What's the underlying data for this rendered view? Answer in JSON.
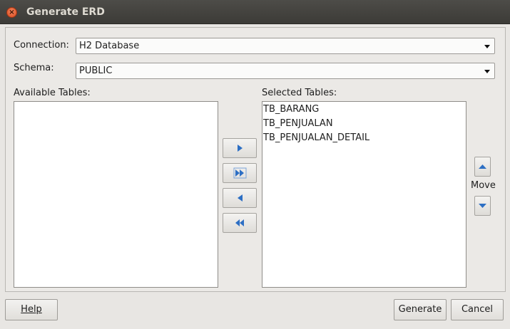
{
  "window": {
    "title": "Generate ERD"
  },
  "form": {
    "connection_label": "Connection:",
    "connection_value": "H2 Database",
    "schema_label": "Schema:",
    "schema_value": "PUBLIC"
  },
  "lists": {
    "available_label": "Available Tables:",
    "available_items": [],
    "selected_label": "Selected Tables:",
    "selected_items": [
      "TB_BARANG",
      "TB_PENJUALAN",
      "TB_PENJUALAN_DETAIL"
    ]
  },
  "transfer_icons": [
    "add-selected-icon",
    "add-all-icon",
    "remove-selected-icon",
    "remove-all-icon"
  ],
  "move": {
    "label": "Move"
  },
  "buttons": {
    "help": "Help",
    "generate": "Generate",
    "cancel": "Cancel"
  },
  "colors": {
    "arrow_blue": "#2d6fc4",
    "close_orange": "#e0592b"
  }
}
